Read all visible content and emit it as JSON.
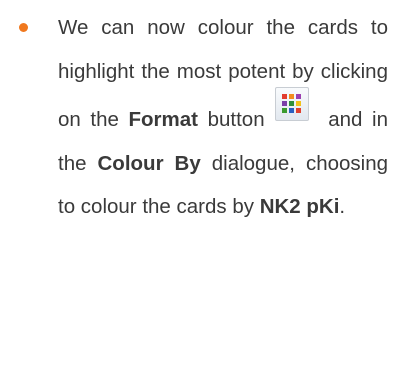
{
  "bullet": {
    "color": "#f0781e",
    "segments": {
      "s1": "We can now colour the cards to highlight the most potent by clicking on the ",
      "format_bold": "Format",
      "s2": "button",
      "s3": " and in the ",
      "colour_by_bold": "Colour By",
      "s4": " dialogue, choosing to colour the cards by ",
      "nk2_bold": "NK2 pKi",
      "s5": "."
    },
    "icon": "format-grid-icon"
  }
}
